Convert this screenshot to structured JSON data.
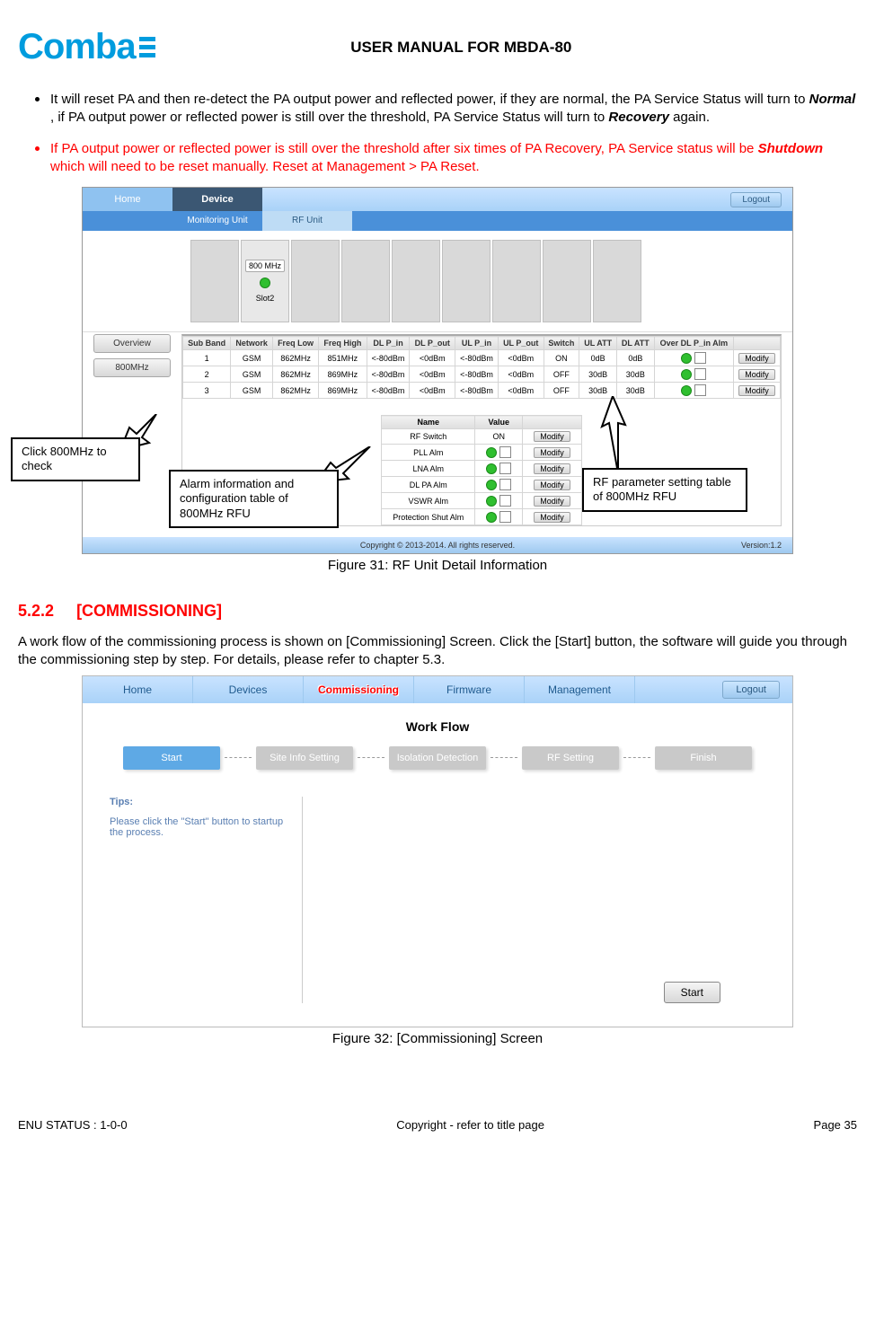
{
  "header": {
    "logo_text": "Comba",
    "doc_title": "USER MANUAL FOR MBDA-80"
  },
  "bullets": {
    "b1_a": "It will reset PA and then re-detect the PA output power and reflected power, if they are normal, the PA Service Status will turn to ",
    "b1_normal": "Normal",
    "b1_b": ", if PA output power or reflected power is still over the threshold, PA Service Status will turn to ",
    "b1_recovery": "Recovery",
    "b1_c": " again.",
    "b2_a": "If PA output power or reflected power is still over the threshold after six times of PA Recovery, PA Service status will be ",
    "b2_shutdown": "Shutdown",
    "b2_b": " which will need to be reset manually. Reset at Management > PA Reset."
  },
  "fig1": {
    "caption": "Figure 31: RF Unit Detail Information",
    "nav": {
      "home": "Home",
      "device": "Device",
      "logout": "Logout"
    },
    "subnav": {
      "monitoring": "Monitoring Unit",
      "rf": "RF Unit"
    },
    "slot": {
      "label": "800 MHz",
      "slotname": "Slot2"
    },
    "sidebtns": {
      "overview": "Overview",
      "band": "800MHz"
    },
    "table": {
      "headers": [
        "Sub Band",
        "Network",
        "Freq Low",
        "Freq High",
        "DL P_in",
        "DL P_out",
        "UL P_in",
        "UL P_out",
        "Switch",
        "UL ATT",
        "DL ATT",
        "Over DL P_in Alm",
        ""
      ],
      "rows": [
        [
          "1",
          "GSM",
          "862MHz",
          "851MHz",
          "<-80dBm",
          "<0dBm",
          "<-80dBm",
          "<0dBm",
          "ON",
          "0dB",
          "0dB",
          "led-chk",
          "Modify"
        ],
        [
          "2",
          "GSM",
          "862MHz",
          "869MHz",
          "<-80dBm",
          "<0dBm",
          "<-80dBm",
          "<0dBm",
          "OFF",
          "30dB",
          "30dB",
          "led-chk",
          "Modify"
        ],
        [
          "3",
          "GSM",
          "862MHz",
          "869MHz",
          "<-80dBm",
          "<0dBm",
          "<-80dBm",
          "<0dBm",
          "OFF",
          "30dB",
          "30dB",
          "led-chk",
          "Modify"
        ]
      ]
    },
    "alarm_table": {
      "headers": [
        "Name",
        "Value",
        ""
      ],
      "rows": [
        [
          "RF Switch",
          "ON",
          "Modify"
        ],
        [
          "PLL Alm",
          "led-chk",
          "Modify"
        ],
        [
          "LNA Alm",
          "led-chk",
          "Modify"
        ],
        [
          "DL PA Alm",
          "led-chk",
          "Modify"
        ],
        [
          "VSWR Alm",
          "led-chk",
          "Modify"
        ],
        [
          "Protection Shut Alm",
          "led-chk",
          "Modify"
        ]
      ]
    },
    "footer": {
      "copyright": "Copyright © 2013-2014. All rights reserved.",
      "version": "Version:1.2"
    },
    "callouts": {
      "c1": "Click 800MHz to check",
      "c2": "Alarm information and configuration table of 800MHz RFU",
      "c3": "RF parameter setting table of 800MHz RFU"
    }
  },
  "section": {
    "num": "5.2.2",
    "title": "[COMMISSIONING]",
    "para": "A work flow of the commissioning process is shown on [Commissioning] Screen. Click the [Start] button, the software will guide you through the commissioning step by step. For details, please refer to chapter 5.3."
  },
  "fig2": {
    "caption": "Figure 32: [Commissioning] Screen",
    "nav": {
      "home": "Home",
      "devices": "Devices",
      "commissioning": "Commissioning",
      "firmware": "Firmware",
      "management": "Management",
      "logout": "Logout"
    },
    "workflow": {
      "title": "Work Flow",
      "steps": [
        "Start",
        "Site Info Setting",
        "Isolation Detection",
        "RF Setting",
        "Finish"
      ]
    },
    "tips": {
      "heading": "Tips:",
      "text": "Please click the \"Start\" button to startup the process."
    },
    "start_btn": "Start"
  },
  "page_footer": {
    "left": "ENU STATUS : 1-0-0",
    "center": "Copyright - refer to title page",
    "right": "Page 35"
  }
}
